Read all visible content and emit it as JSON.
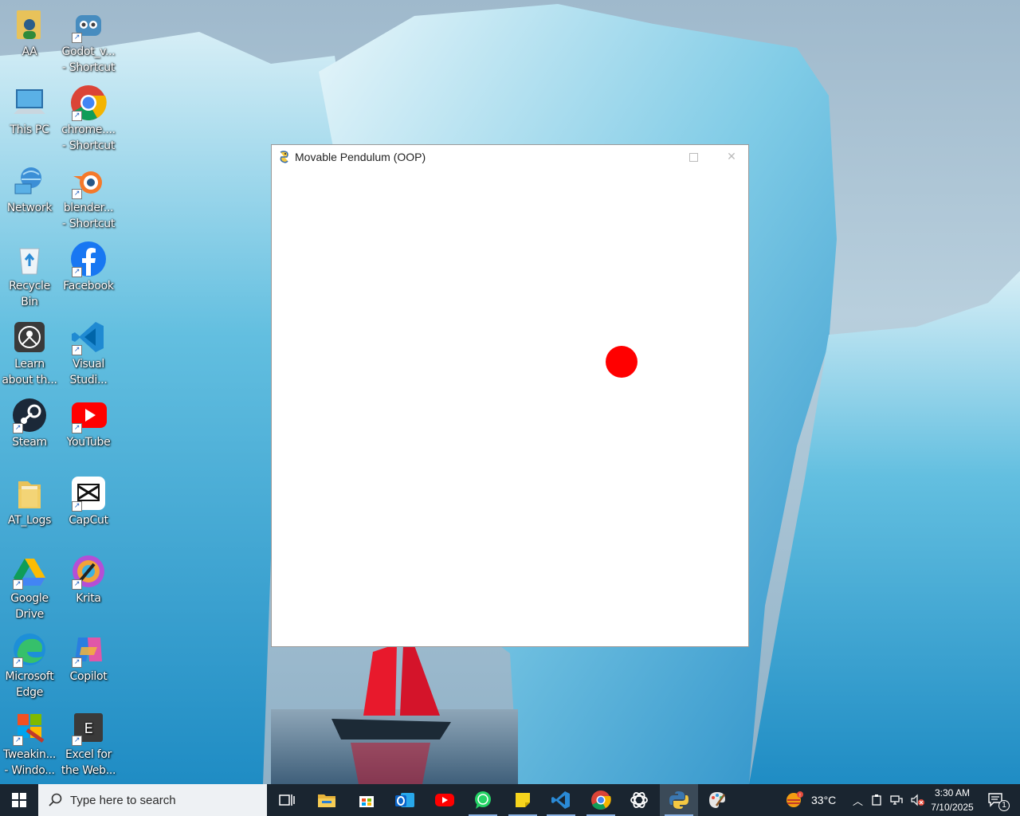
{
  "desktop": {
    "icons": [
      {
        "label": "AA",
        "icon": "user-folder-icon"
      },
      {
        "label": "Godot_v...\n- Shortcut",
        "icon": "godot-icon"
      },
      {
        "label": "This PC",
        "icon": "this-pc-icon"
      },
      {
        "label": "chrome....\n- Shortcut",
        "icon": "chrome-icon"
      },
      {
        "label": "Network",
        "icon": "network-icon"
      },
      {
        "label": "blender...\n- Shortcut",
        "icon": "blender-icon"
      },
      {
        "label": "Recycle\nBin",
        "icon": "recycle-bin-icon"
      },
      {
        "label": "Facebook",
        "icon": "facebook-icon"
      },
      {
        "label": "Learn\nabout th...",
        "icon": "learn-icon"
      },
      {
        "label": "Visual\nStudi...",
        "icon": "vscode-icon"
      },
      {
        "label": "Steam",
        "icon": "steam-icon"
      },
      {
        "label": "YouTube",
        "icon": "youtube-icon"
      },
      {
        "label": "AT_Logs",
        "icon": "folder-icon"
      },
      {
        "label": "CapCut",
        "icon": "capcut-icon"
      },
      {
        "label": "Google\nDrive",
        "icon": "google-drive-icon"
      },
      {
        "label": "Krita",
        "icon": "krita-icon"
      },
      {
        "label": "Microsoft\nEdge",
        "icon": "edge-icon"
      },
      {
        "label": "Copilot",
        "icon": "copilot-icon"
      },
      {
        "label": "Tweakin...\n- Windo...",
        "icon": "tweaking-icon"
      },
      {
        "label": "Excel for\nthe Web...",
        "icon": "excel-web-icon"
      }
    ]
  },
  "window": {
    "title": "Movable Pendulum (OOP)",
    "app_icon": "pygame-snake-icon",
    "bob_color": "#ff0000"
  },
  "taskbar": {
    "search_placeholder": "Type here to search",
    "apps": [
      "task-view",
      "file-explorer",
      "microsoft-store",
      "outlook",
      "youtube",
      "whatsapp",
      "sticky-notes",
      "vscode",
      "chrome",
      "chatgpt",
      "python",
      "paint"
    ],
    "temperature": "33°C",
    "time": "3:30 AM",
    "date": "7/10/2025",
    "notification_count": "1"
  },
  "colors": {
    "taskbar_bg": "#1a2530",
    "accent": "#8cb4e6"
  }
}
